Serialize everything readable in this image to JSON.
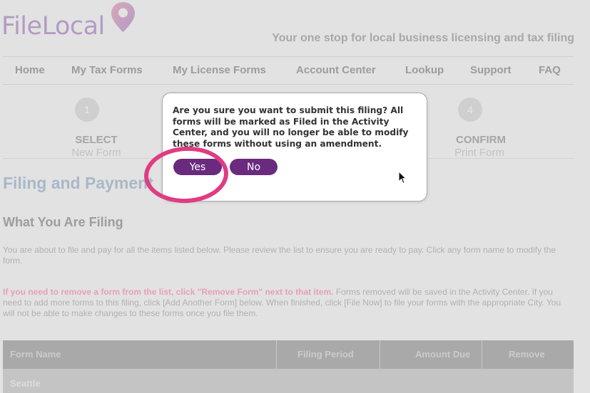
{
  "header": {
    "logo_text": "FileLocal",
    "tagline": "Your one stop for local business licensing and tax filing"
  },
  "nav": {
    "items": [
      "Home",
      "My Tax Forms",
      "My License Forms",
      "Account Center",
      "Lookup",
      "Support",
      "FAQ"
    ]
  },
  "steps": [
    {
      "number": "1",
      "title": "SELECT",
      "subtitle": "New Form"
    },
    {
      "number": "4",
      "title": "CONFIRM",
      "subtitle": "Print Form"
    }
  ],
  "page": {
    "heading": "Filing and Payment",
    "section_heading": "What You Are Filing",
    "intro": "You are about to file and pay for all the items listed below. Please review the list to ensure you are ready to pay. Click any form name to modify the form.",
    "warning": "If you need to remove a form from the list, click \"Remove Form\" next to that item.",
    "instructions": " Forms removed will be saved in the Activity Center. If you need to add more forms to this filing, click [Add Another Form] below. When finished, click [File Now] to file your forms with the appropriate City. You will not be able to make changes to these forms once you file them."
  },
  "table": {
    "columns": [
      "Form Name",
      "Filing Period",
      "Amount Due",
      "Remove"
    ],
    "rows": [
      {
        "label": "Seattle"
      }
    ]
  },
  "modal": {
    "message": "Are you sure you want to submit this filing? All forms will be marked as Filed in the Activity Center, and you will no longer be able to modify these forms without using an amendment.",
    "yes_label": "Yes",
    "no_label": "No"
  },
  "colors": {
    "brand_purple": "#6a2a7e",
    "annotation_pink": "#e03c82",
    "logo_lavender": "#b39bc4"
  }
}
